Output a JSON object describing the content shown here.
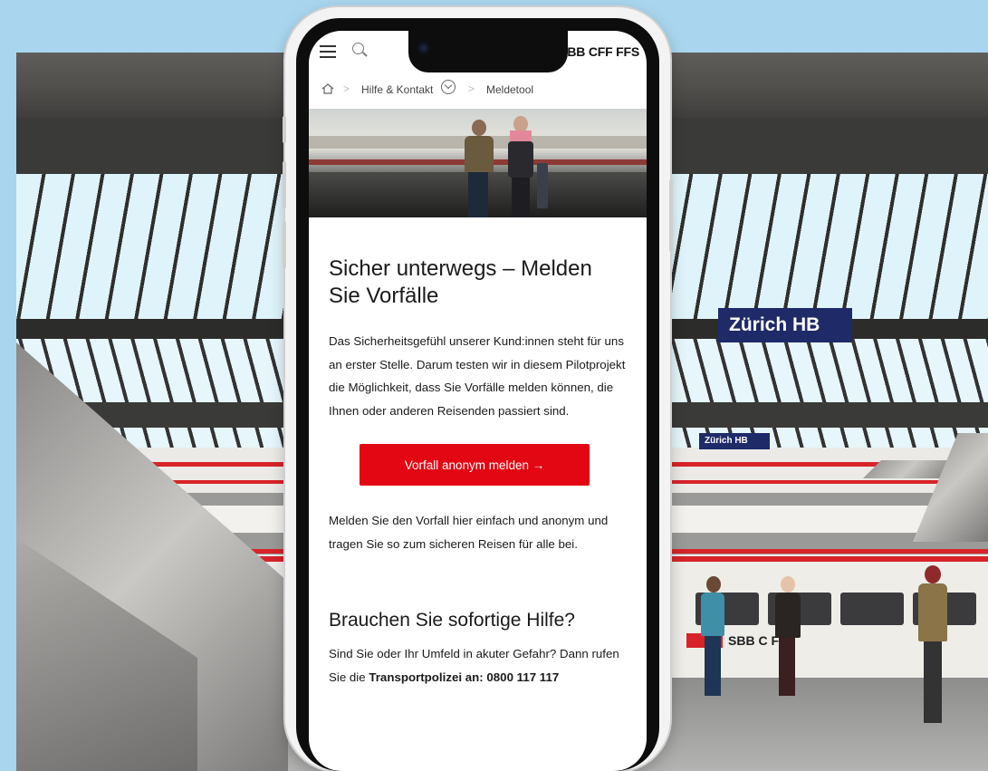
{
  "background": {
    "station_sign_large": "Zürich HB",
    "station_sign_small": "Zürich HB",
    "train_logo_text": "SBB C   FS",
    "colors": {
      "sky": "#a9d6ee",
      "sign": "#1f2a68",
      "train_red": "#d8232a"
    }
  },
  "phone": {
    "header": {
      "menu_icon": "hamburger-icon",
      "search_icon": "search-icon",
      "brand": "SBB CFF FFS"
    },
    "breadcrumb": {
      "home_icon": "home-icon",
      "items": [
        "Hilfe & Kontakt",
        "Meldetool"
      ]
    },
    "page": {
      "title": "Sicher unterwegs – Melden Sie Vorfälle",
      "intro": "Das Sicherheitsgefühl unserer Kund:innen steht für uns an erster Stelle. Darum testen wir in diesem Pilotprojekt die Möglichkeit, dass Sie Vorfälle melden können, die Ihnen oder anderen Reisenden passiert sind.",
      "cta_label": "Vorfall anonym melden →",
      "description": "Melden Sie den Vorfall hier einfach und anonym und tragen Sie so zum sicheren Reisen für alle bei.",
      "help_heading": "Brauchen Sie sofortige Hilfe?",
      "help_text_prefix": "Sind Sie oder Ihr Umfeld in akuter Gefahr? Dann rufen Sie die ",
      "help_text_bold": "Transportpolizei an: 0800 117 117"
    },
    "colors": {
      "cta": "#e30613",
      "brand_red": "#d8232a"
    }
  }
}
